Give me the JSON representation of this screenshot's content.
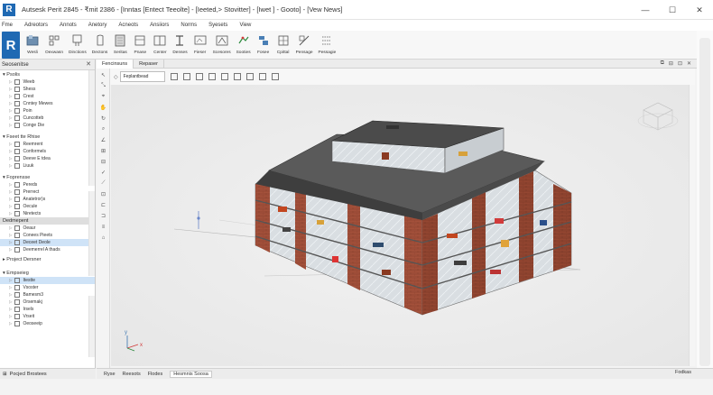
{
  "window": {
    "app_logo": "R",
    "title": "Autsesk Perit 2845 - ₹mit 2386 - [Inntas [Entect Teeolte] - [Ieeted,> Stovitter] - [Iwet ] - Gooto] - [Vew News]",
    "controls": [
      "—",
      "☐",
      "✕"
    ]
  },
  "menu": [
    "Fme",
    "Adreotors",
    "Annots",
    "Anetory",
    "Acneots",
    "Ansiiors",
    "Norms",
    "Syesets",
    "View"
  ],
  "ribbon": {
    "app_button": "R",
    "buttons": [
      {
        "label": "Wesli",
        "icon": "wall-icon"
      },
      {
        "label": "Oexwasn",
        "icon": "door-icon"
      },
      {
        "label": "Dinctions",
        "icon": "window-icon"
      },
      {
        "label": "Dectons",
        "icon": "component-icon"
      },
      {
        "label": "Seritas",
        "icon": "column-icon"
      },
      {
        "label": "Pnase",
        "icon": "roof-icon"
      },
      {
        "label": "Center",
        "icon": "ceiling-icon"
      },
      {
        "label": "Denses",
        "icon": "floor-icon"
      },
      {
        "label": "Fieser",
        "icon": "curtain-icon"
      },
      {
        "label": "Scesores",
        "icon": "railing-icon"
      },
      {
        "label": "Sooties",
        "icon": "stair-icon"
      },
      {
        "label": "Fosee",
        "icon": "ramp-icon"
      },
      {
        "label": "Cpittal",
        "icon": "model-icon"
      },
      {
        "label": "Pensage",
        "icon": "room-icon"
      },
      {
        "label": "Pessagie",
        "icon": "grid-icon"
      }
    ]
  },
  "project_browser": {
    "title": "Seosenitse",
    "sections": [
      {
        "title": "Psolis",
        "items": [
          {
            "label": "Weeb"
          },
          {
            "label": "Shess"
          },
          {
            "label": "Crest"
          },
          {
            "label": "Cnntey Mewes"
          },
          {
            "label": "Poin"
          },
          {
            "label": "Cuncotteb"
          },
          {
            "label": "Conge Die"
          }
        ]
      },
      {
        "title": "Fseet tte Rhise",
        "items": [
          {
            "label": "Reemrent"
          },
          {
            "label": "Conformels"
          },
          {
            "label": "Deeve E tdea"
          },
          {
            "label": "Liuuk"
          }
        ]
      },
      {
        "title": "Foprensse",
        "items": [
          {
            "label": "Pereds"
          },
          {
            "label": "Prerrect"
          },
          {
            "label": "Anatetror)s"
          },
          {
            "label": "Oecule"
          },
          {
            "label": "Niretects"
          }
        ]
      },
      {
        "title": "Dedmepent",
        "items": [
          {
            "label": "Oeaur"
          },
          {
            "label": "Conees Pieets"
          },
          {
            "label": "Deceet Deole",
            "selected": true
          },
          {
            "label": "Deemerrel A thads"
          }
        ]
      },
      {
        "title": "Project Dersner",
        "items": []
      },
      {
        "title": "Empseieg",
        "items": [
          {
            "label": "Itestte",
            "selected": true
          },
          {
            "label": "Vsoster"
          },
          {
            "label": "Bamesm3"
          },
          {
            "label": "Orsemakj"
          },
          {
            "label": "Irsels"
          },
          {
            "label": "Vrseit"
          },
          {
            "label": "Oeoseeip"
          }
        ]
      }
    ],
    "footer": "Pocjecl Brostees"
  },
  "view_tabs": [
    {
      "label": "Fencinsuns",
      "active": true
    },
    {
      "label": "Repaser",
      "active": false
    }
  ],
  "view_tab_controls": [
    "⧉",
    "⊟",
    "⊡",
    "✕"
  ],
  "view_toolbar": {
    "selector": "Feplantbead"
  },
  "vertical_tools": [
    "↖",
    "⤡",
    "⌖",
    "✋",
    "↻",
    "⌕",
    "∠",
    "⊞",
    "⊟",
    "✓",
    "⟋",
    "⊡",
    "⊏",
    "⊐",
    "≡",
    "⌂"
  ],
  "bottom_tabs": [
    "Ryse",
    "Reesots",
    "Flodes",
    "Hesmnis Soosa"
  ],
  "footer_right": "Fodkas",
  "canvas_axis": {
    "x": "x",
    "y": "y"
  }
}
